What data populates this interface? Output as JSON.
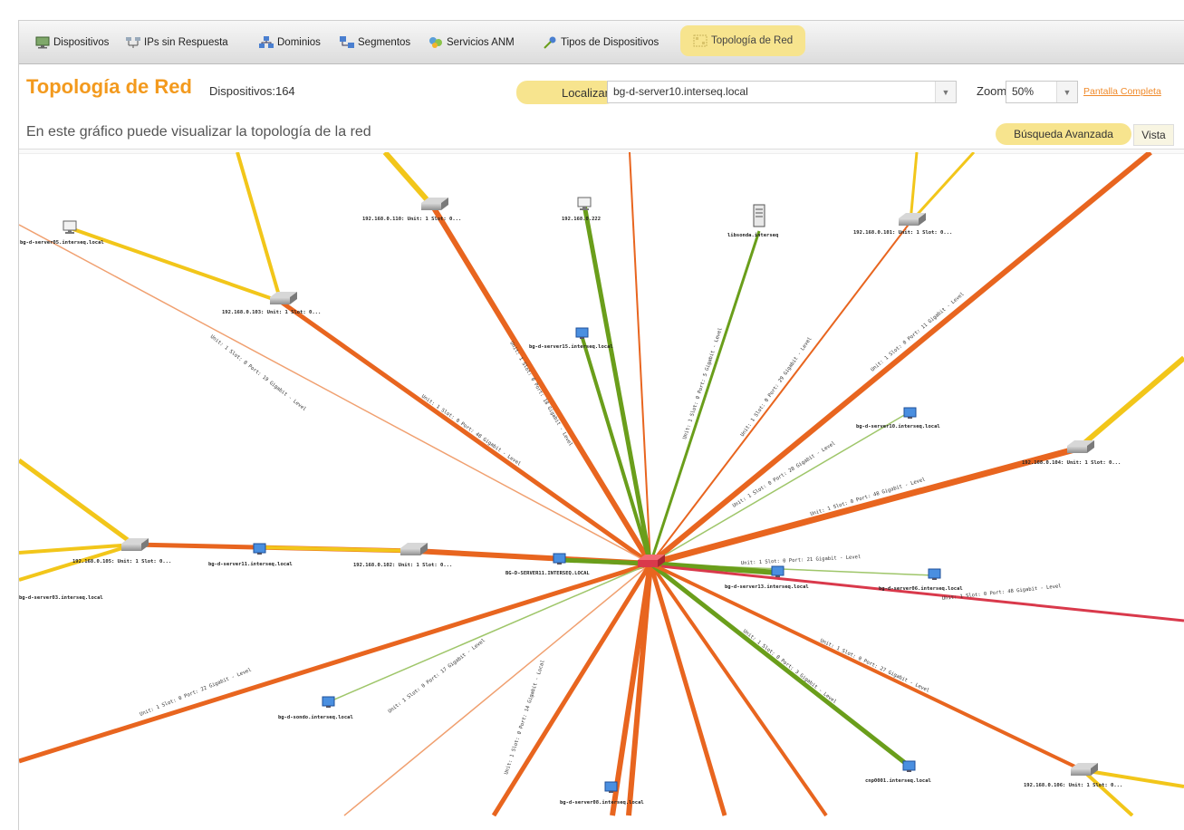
{
  "nav": {
    "items": [
      {
        "label": "Dispositivos",
        "icon": "monitor-icon"
      },
      {
        "label": "IPs sin Respuesta",
        "icon": "network-icon"
      },
      {
        "label": "Dominios",
        "icon": "domains-icon"
      },
      {
        "label": "Segmentos",
        "icon": "segments-icon"
      },
      {
        "label": "Servicios ANM",
        "icon": "services-icon"
      },
      {
        "label": "Tipos de Dispositivos",
        "icon": "device-types-icon"
      },
      {
        "label": "Topología de Red",
        "icon": "topology-icon",
        "active": true
      }
    ]
  },
  "header": {
    "title": "Topología de Red",
    "device_count": "Dispositivos:164",
    "locate_label": "Localizar",
    "locate_value": "bg-d-server10.interseq.local",
    "zoom_label": "Zoom",
    "zoom_value": "50%",
    "fullscreen_link": "Pantalla Completa"
  },
  "description": "En este gráfico puede visualizar la topología de la red",
  "actions": {
    "advanced_search": "Búsqueda Avanzada",
    "view": "Vista"
  },
  "colors": {
    "accent": "#f39a1e",
    "highlight": "#f7e48e",
    "link_orange": "#e8651f",
    "link_green": "#6a9e1b",
    "link_yellow": "#f2c61a",
    "link_red": "#d9394b",
    "link_light_green": "#9fc66a",
    "link_light_orange": "#f0a070"
  },
  "graph": {
    "nodes": [
      {
        "name": "central-switch-node",
        "type": "switch-red"
      },
      {
        "name": "switch-node-1",
        "type": "switch",
        "label": "192.168.0.110: Unit: 1 Slot: 0..."
      },
      {
        "name": "switch-node-2",
        "type": "switch",
        "label": "192.168.0.103: Unit: 1 Slot: 0..."
      },
      {
        "name": "switch-node-3",
        "type": "switch",
        "label": "192.168.0.101: Unit: 1 Slot: 0..."
      },
      {
        "name": "switch-node-4",
        "type": "switch",
        "label": "192.168.0.104: Unit: 1 Slot: 0..."
      },
      {
        "name": "switch-node-5",
        "type": "switch",
        "label": "192.168.0.105: Unit: 1 Slot: 0..."
      },
      {
        "name": "switch-node-6",
        "type": "switch",
        "label": "192.168.0.102: Unit: 1 Slot: 0..."
      },
      {
        "name": "switch-node-7",
        "type": "switch",
        "label": "192.168.0.106: Unit: 1 Slot: 0..."
      },
      {
        "name": "pc-node-1",
        "type": "pc",
        "label": "bg-d-server05.interseq.local"
      },
      {
        "name": "pc-node-2",
        "type": "pc",
        "label": "192.168.0.222"
      },
      {
        "name": "server-node-1",
        "type": "server",
        "label": "libsonda.interseq"
      },
      {
        "name": "pc-node-3",
        "type": "pc-blue",
        "label": "bg-d-server15.interseq.local"
      },
      {
        "name": "pc-node-4",
        "type": "pc-blue",
        "label": "bg-d-server10.interseq.local"
      },
      {
        "name": "pc-node-5",
        "type": "pc-blue",
        "label": "bg-d-server11.interseq.local"
      },
      {
        "name": "pc-node-6",
        "type": "pc-blue",
        "label": "BG-D-SERVER11.INTERSEQ.LOCAL"
      },
      {
        "name": "pc-node-7",
        "type": "pc-blue",
        "label": "bg-d-server13.interseq.local"
      },
      {
        "name": "pc-node-8",
        "type": "pc-blue",
        "label": "bg-d-server06.interseq.local"
      },
      {
        "name": "pc-node-9",
        "type": "pc-blue",
        "label": "bg-d-sondo.interseq.local"
      },
      {
        "name": "pc-node-10",
        "type": "pc-blue",
        "label": "bg-d-server08.interseq.local"
      },
      {
        "name": "pc-node-11",
        "type": "pc-blue",
        "label": "cnp0001.interseq.local"
      },
      {
        "name": "pc-node-12",
        "type": "pc-blue",
        "label": "bg-d-server03.interseq.local"
      }
    ],
    "link_labels": [
      "Unit: 1 Slot: 0 Port: 19 Gigabit - Level",
      "Unit: 1 Slot: 0 Port: 48 Gigabit - Level",
      "Unit: 1 Slot: 0 Port: 18 Gigabit - Level",
      "Unit: 1 Slot: 0 Port: 11 Gigabit - Level",
      "Unit: 1 Slot: 0 Port: 5 Gigabit - Level",
      "Unit: 1 Slot: 0 Port: 29 Gigabit - Level",
      "Unit: 1 Slot: 0 Port: 48 Gigabit - Level",
      "Unit: 1 Slot: 0 Port: 21 Gigabit - Level",
      "Unit: 1 Slot: 0 Port: 22 Gigabit - Level",
      "Unit: 1 Slot: 0 Port: 28 Gigabit - Level",
      "Unit: 1 Slot: 0 Port: 17 Gigabit - Level",
      "Unit: 1 Slot: 0 Port: 14 Gigabit - Local",
      "Unit: 1 Slot: 0 Port: 3 Gigabit - Level",
      "Unit: 1 Slot: 0 Port: 27 Gigabit - Level",
      "Unit: 1 Slot: 0 Port: 48 Gigabit - Level"
    ]
  }
}
